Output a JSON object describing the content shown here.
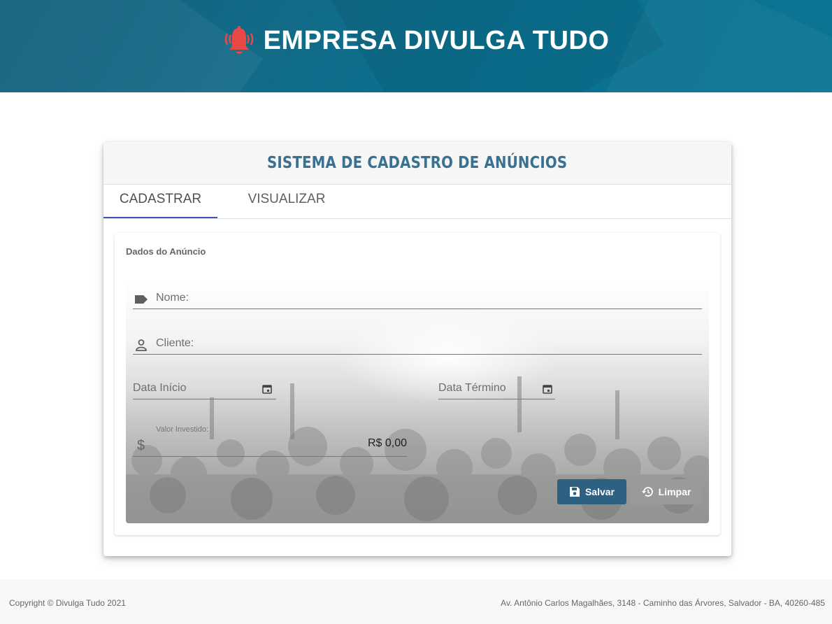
{
  "header": {
    "brand_title": "EMPRESA DIVULGA TUDO",
    "brand_icon": "bell-icon",
    "bell_color": "#e94848"
  },
  "card": {
    "title": "SISTEMA DE CADASTRO DE ANÚNCIOS",
    "tabs": [
      {
        "label": "CADASTRAR",
        "active": true
      },
      {
        "label": "VISUALIZAR",
        "active": false
      }
    ]
  },
  "form": {
    "section_label": "Dados do Anúncio",
    "nome_label": "Nome:",
    "cliente_label": "Cliente:",
    "data_inicio_label": "Data Início",
    "data_termino_label": "Data Término",
    "valor_label": "Valor Investido:",
    "valor_prefix": "$",
    "valor_value": "R$ 0,00",
    "save_label": "Salvar",
    "clear_label": "Limpar"
  },
  "footer": {
    "copyright": "Copyright © Divulga Tudo 2021",
    "address": "Av. Antônio Carlos Magalhães, 3148 - Caminho das Árvores, Salvador - BA, 40260-485"
  },
  "colors": {
    "header_bg": "#0f6a86",
    "title_color": "#3b7190",
    "tab_indicator": "#3f51b5",
    "save_button": "#2d6081",
    "clear_button": "#9a9a9a"
  }
}
